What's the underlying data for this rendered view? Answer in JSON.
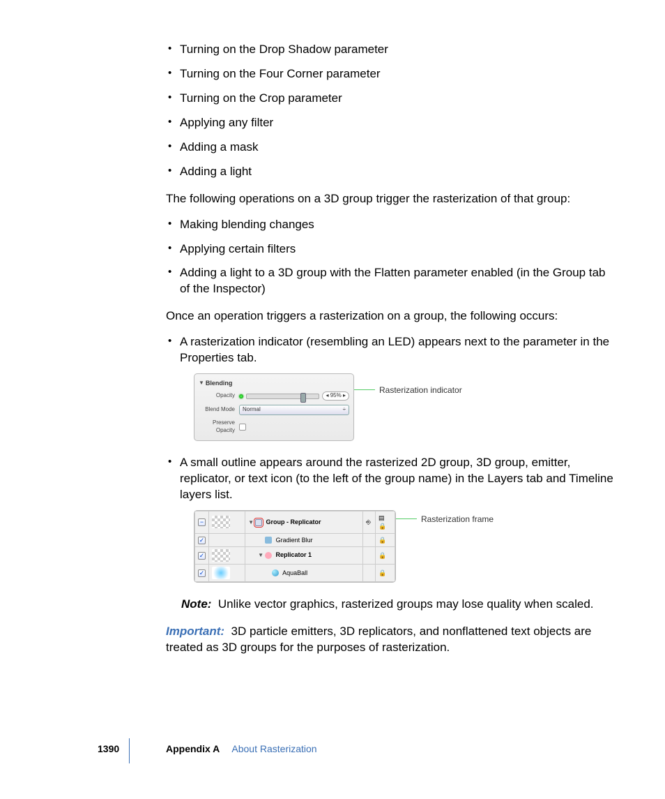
{
  "bullets_top": [
    "Turning on the Drop Shadow parameter",
    "Turning on the Four Corner parameter",
    "Turning on the Crop parameter",
    "Applying any filter",
    "Adding a mask",
    "Adding a light"
  ],
  "para1": "The following operations on a 3D group trigger the rasterization of that group:",
  "bullets_3d": [
    "Making blending changes",
    "Applying certain filters",
    "Adding a light to a 3D group with the Flatten parameter enabled (in the Group tab of the Inspector)"
  ],
  "para2": "Once an operation triggers a rasterization on a group, the following occurs:",
  "bullet_indicator": "A rasterization indicator (resembling an LED) appears next to the parameter in the Properties tab.",
  "panel": {
    "header": "Blending",
    "opacity_label": "Opacity",
    "opacity_value": "95%",
    "blendmode_label": "Blend Mode",
    "blendmode_value": "Normal",
    "preserve_label": "Preserve Opacity"
  },
  "callout1": "Rasterization indicator",
  "bullet_outline": "A small outline appears around the rasterized 2D group, 3D group, emitter, replicator, or text icon (to the left of the group name) in the Layers tab and Timeline layers list.",
  "layers": {
    "row1": "Group - Replicator",
    "row2": "Gradient Blur",
    "row3": "Replicator 1",
    "row4": "AquaBall"
  },
  "callout2": "Rasterization frame",
  "note_label": "Note:",
  "note_text": "Unlike vector graphics, rasterized groups may lose quality when scaled.",
  "important_label": "Important:",
  "important_text": "3D particle emitters, 3D replicators, and nonflattened text objects are treated as 3D groups for the purposes of rasterization.",
  "footer": {
    "page": "1390",
    "appendix": "Appendix A",
    "title": "About Rasterization"
  }
}
